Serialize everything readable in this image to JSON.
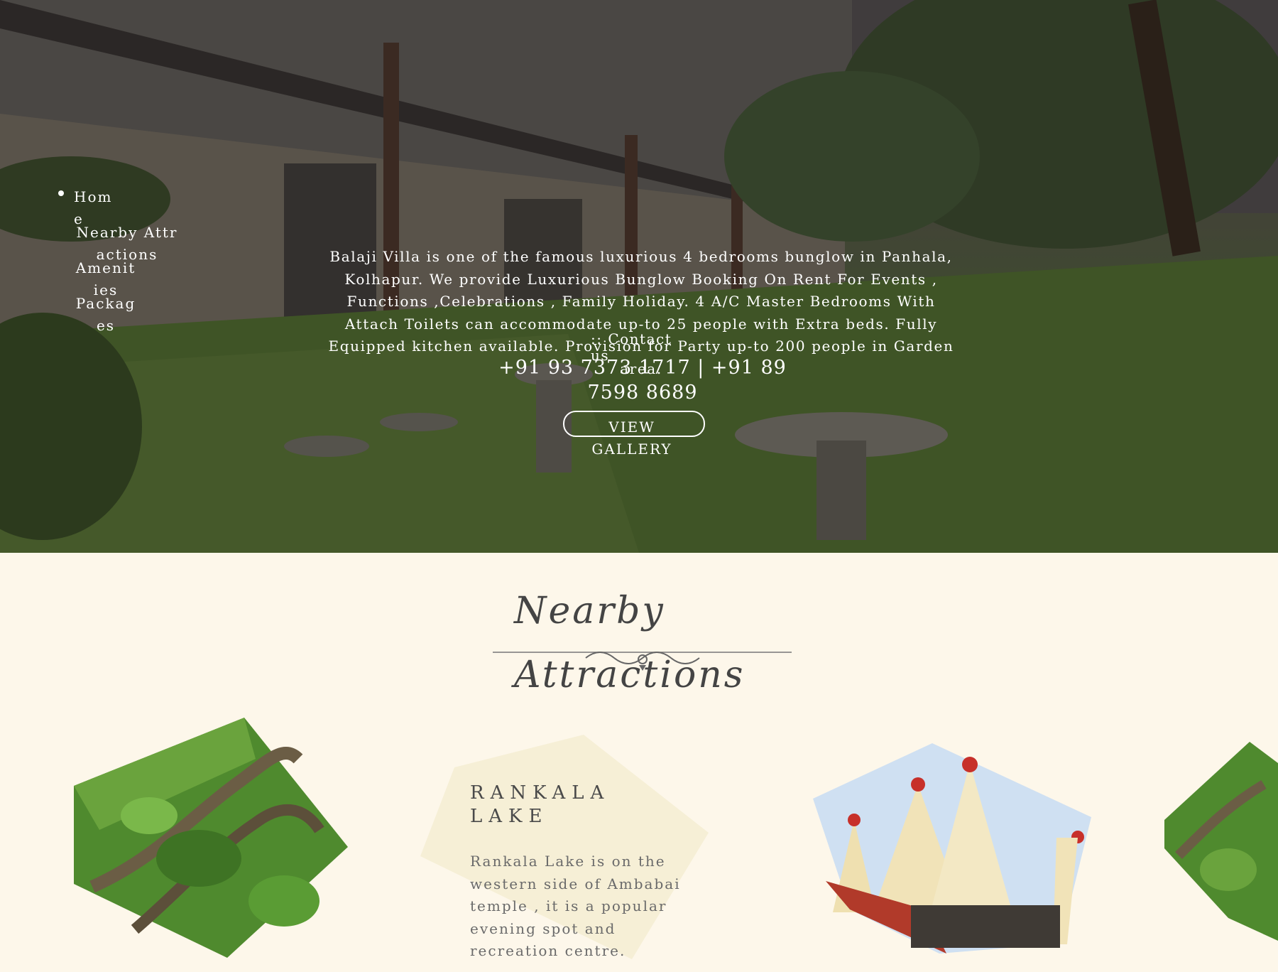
{
  "nav": {
    "items": [
      {
        "label": "Home"
      },
      {
        "label": "Nearby Attractions"
      },
      {
        "label": "Amenities"
      },
      {
        "label": "Packages"
      }
    ]
  },
  "hero": {
    "intro": "Balaji Villa is one of the famous luxurious 4 bedrooms bunglow in Panhala, Kolhapur. We provide Luxurious Bunglow Booking On Rent For Events , Functions ,Celebrations , Family Holiday. 4 A/C Master Bedrooms With Attach Toilets can accommodate up-to 25 people with Extra beds. Fully Equipped kitchen available. Provision for Party up-to 200 people in Garden area.",
    "contact_label": ":: Contact us",
    "phones": "+91 93 7373 1717   |   +91 89 7598 8689",
    "gallery_button": "VIEW GALLERY"
  },
  "section": {
    "title_line1": "Nearby",
    "title_line2": "Attractions"
  },
  "attraction": {
    "name": "RANKALA LAKE",
    "description": "Rankala Lake is on the western side of Ambabai temple , it is a popular evening spot and recreation centre."
  },
  "colors": {
    "page_background": "#fdf7ea",
    "card_background": "#f6efd6",
    "text_dark": "#444444"
  }
}
